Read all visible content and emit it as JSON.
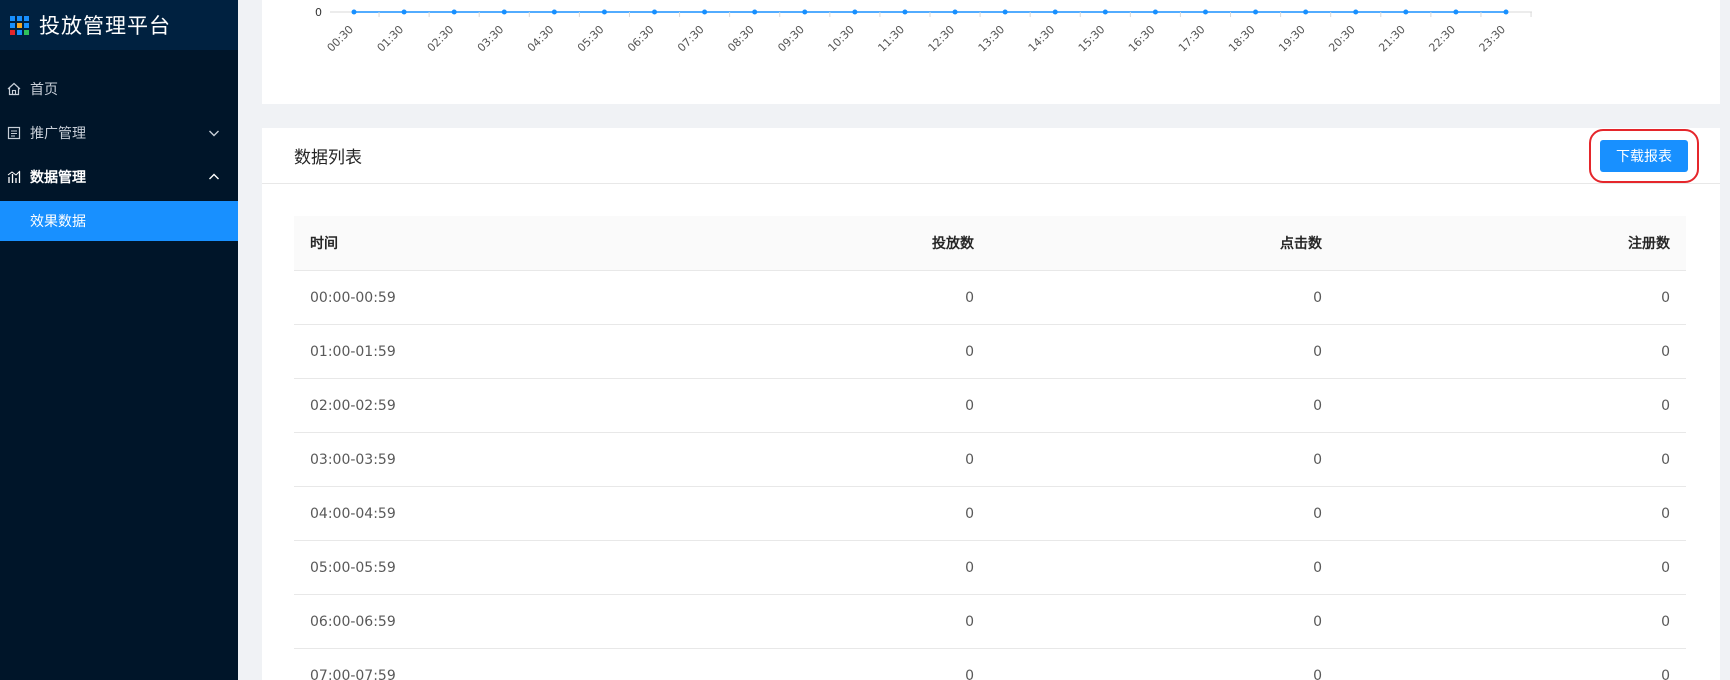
{
  "app": {
    "title": "投放管理平台"
  },
  "sidebar": {
    "items": [
      {
        "label": "首页",
        "icon": "home-icon"
      },
      {
        "label": "推广管理",
        "icon": "document-icon",
        "expanded": false
      },
      {
        "label": "数据管理",
        "icon": "chart-icon",
        "expanded": true,
        "children": [
          {
            "label": "效果数据",
            "active": true
          }
        ]
      }
    ]
  },
  "chart_data": {
    "type": "line",
    "x": [
      "00:30",
      "01:30",
      "02:30",
      "03:30",
      "04:30",
      "05:30",
      "06:30",
      "07:30",
      "08:30",
      "09:30",
      "10:30",
      "11:30",
      "12:30",
      "13:30",
      "14:30",
      "15:30",
      "16:30",
      "17:30",
      "18:30",
      "19:30",
      "20:30",
      "21:30",
      "22:30",
      "23:30"
    ],
    "series": [
      {
        "values": [
          0,
          0,
          0,
          0,
          0,
          0,
          0,
          0,
          0,
          0,
          0,
          0,
          0,
          0,
          0,
          0,
          0,
          0,
          0,
          0,
          0,
          0,
          0,
          0
        ]
      }
    ],
    "y_tick_visible": "0",
    "color": "#1890ff"
  },
  "list": {
    "title": "数据列表",
    "download_label": "下载报表",
    "columns": [
      "时间",
      "投放数",
      "点击数",
      "注册数"
    ],
    "rows": [
      [
        "00:00-00:59",
        "0",
        "0",
        "0"
      ],
      [
        "01:00-01:59",
        "0",
        "0",
        "0"
      ],
      [
        "02:00-02:59",
        "0",
        "0",
        "0"
      ],
      [
        "03:00-03:59",
        "0",
        "0",
        "0"
      ],
      [
        "04:00-04:59",
        "0",
        "0",
        "0"
      ],
      [
        "05:00-05:59",
        "0",
        "0",
        "0"
      ],
      [
        "06:00-06:59",
        "0",
        "0",
        "0"
      ],
      [
        "07:00-07:59",
        "0",
        "0",
        "0"
      ]
    ]
  },
  "colors": {
    "sidebar_bg": "#001529",
    "accent": "#1890ff",
    "highlight_border": "#e5262b"
  }
}
